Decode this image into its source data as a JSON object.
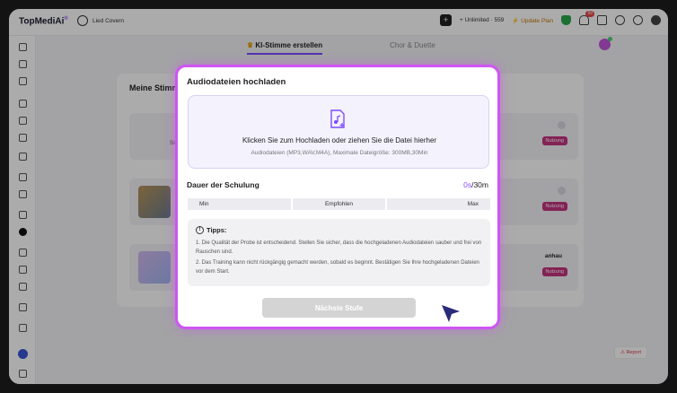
{
  "app": {
    "logo_text": "TopMediAi",
    "logo_sup": "®",
    "user_name": "Lied Covern"
  },
  "topbar": {
    "dark_btn_glyph": "+",
    "unlimited": "+ Unlimited · 559",
    "update_plan": "⚡ Update Plan",
    "notif_count": "99"
  },
  "tabs": [
    {
      "label": "KI-Stimme erstellen",
      "crown": "♛"
    },
    {
      "label": "Chor & Duette"
    }
  ],
  "panel": {
    "title": "Meine Stimm",
    "cards": [
      {
        "left_text": "Si",
        "right_title": "",
        "chip": "Nutzung"
      },
      {
        "left_text": "",
        "right_title": "",
        "chip": "Nutzung"
      },
      {
        "left_text": "",
        "right_title": "anhau",
        "chip": "Nutzung"
      }
    ]
  },
  "report": "⚠ Report",
  "modal": {
    "title": "Audiodateien hochladen",
    "dropzone_main": "Klicken Sie zum Hochladen oder ziehen Sie die Datei hierher",
    "dropzone_sub": "Audiodateien (MP3,WAV,M4A), Maximale Dateigröße: 300MB,30Min",
    "duration_label": "Dauer der Schulung",
    "duration_current": "0s",
    "duration_total": "/30m",
    "segments": [
      "Min",
      "Empfohlen",
      "Max"
    ],
    "tips_heading": "Tipps:",
    "tips": [
      "1. Die Qualität der Probe ist entscheidend. Stellen Sie sicher, dass die hochgeladenen Audiodateien sauber und frei von Rauschen sind.",
      "2. Das Training kann nicht rückgängig gemacht werden, sobald es beginnt. Bestätigen Sie Ihre hochgeladenen Dateien vor dem Start."
    ],
    "next_button": "Nächste Stufe"
  },
  "colors": {
    "accent": "#8a4dff",
    "modal_border": "#cf55f3",
    "chip": "#c4337f"
  }
}
